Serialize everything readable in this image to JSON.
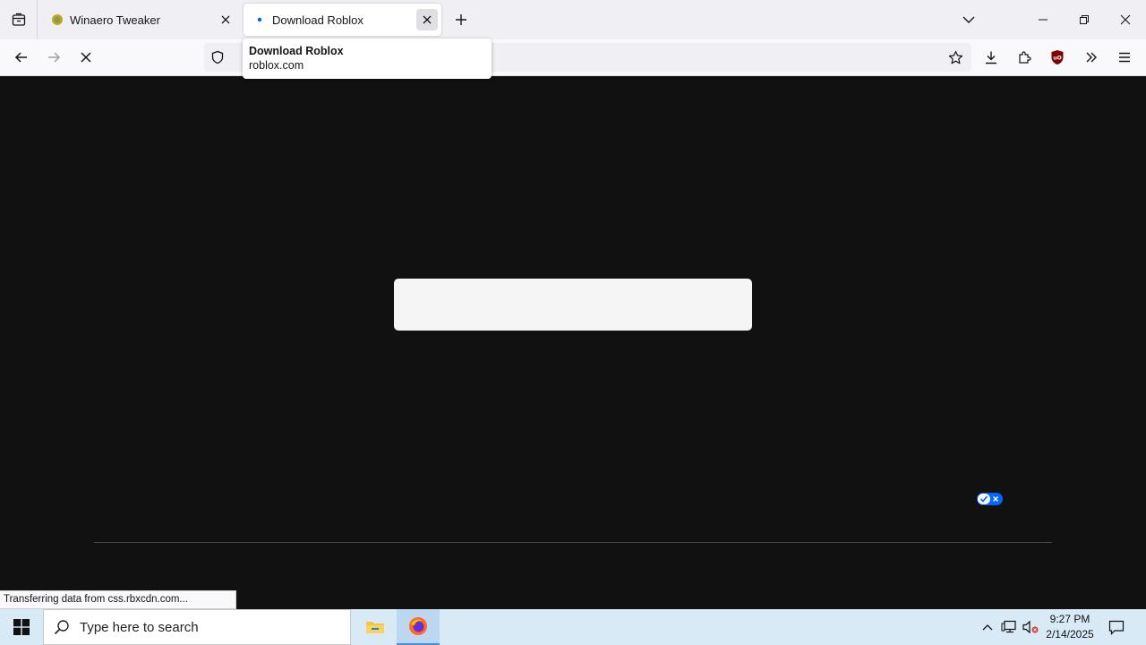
{
  "tabs": [
    {
      "title": "Winaero Tweaker",
      "active": false
    },
    {
      "title": "Download Roblox",
      "active": true
    }
  ],
  "tooltip": {
    "title": "Download Roblox",
    "host": "roblox.com"
  },
  "status": {
    "text": "Transferring data from css.rbxcdn.com..."
  },
  "taskbar": {
    "search_placeholder": "Type here to search",
    "time": "9:27 PM",
    "date": "2/14/2025"
  },
  "colors": {
    "accent": "#0066ff",
    "page_bg": "#111112",
    "taskbar_bg": "#d9eaf7"
  }
}
